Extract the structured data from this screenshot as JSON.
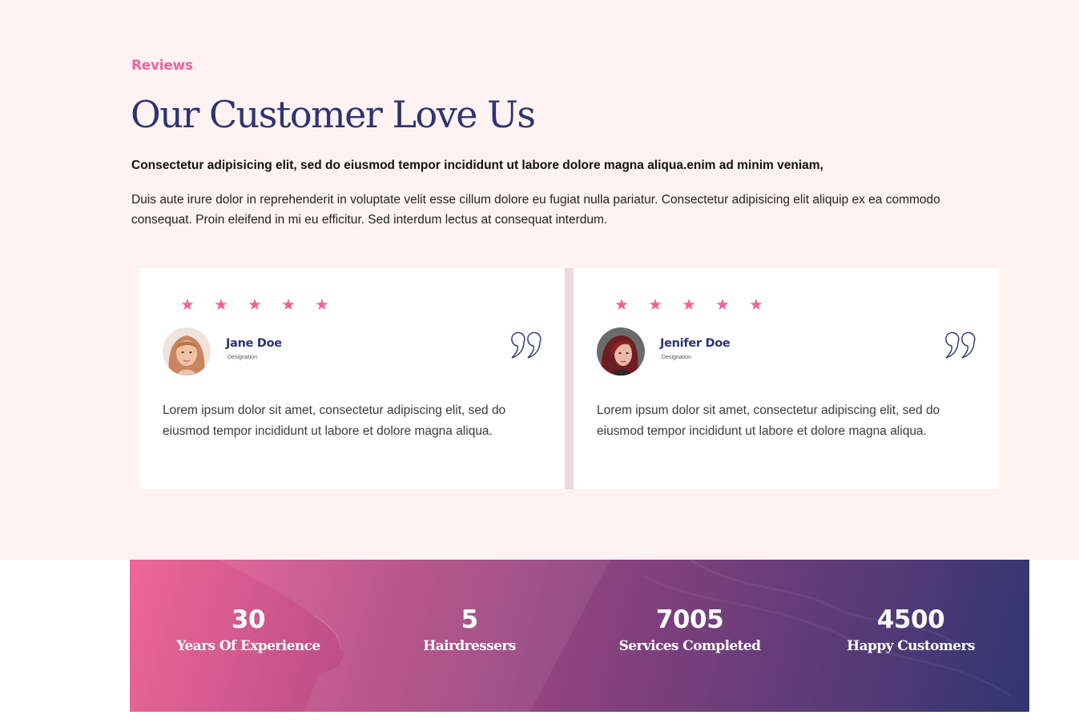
{
  "section": {
    "eyebrow": "Reviews",
    "title": "Our Customer Love Us",
    "lead": "Consectetur adipisicing elit, sed do eiusmod tempor incididunt ut labore dolore magna aliqua.enim ad minim veniam,",
    "body": "Duis aute irure dolor in reprehenderit in voluptate velit esse cillum dolore eu fugiat nulla pariatur. Consectetur adipisicing elit aliquip ex ea commodo consequat. Proin eleifend in mi eu efficitur. Sed interdum lectus at consequat interdum."
  },
  "testimonials": [
    {
      "rating": 5,
      "name": "Jane Doe",
      "role": "Designation",
      "text": "Lorem ipsum dolor sit amet, consectetur adipiscing elit, sed do eiusmod tempor incididunt ut labore et dolore magna aliqua.",
      "icon": "quote-icon"
    },
    {
      "rating": 5,
      "name": "Jenifer Doe",
      "role": "Designation",
      "text": "Lorem ipsum dolor sit amet, consectetur adipiscing elit, sed do eiusmod tempor incididunt ut labore et dolore magna aliqua.",
      "icon": "quote-icon"
    }
  ],
  "stats": [
    {
      "value": "30",
      "label": "Years Of Experience"
    },
    {
      "value": "5",
      "label": "Hairdressers"
    },
    {
      "value": "7005",
      "label": "Services Completed"
    },
    {
      "value": "4500",
      "label": "Happy Customers"
    }
  ],
  "colors": {
    "accent": "#f0639a",
    "navy": "#2c3472",
    "section_bg": "#fff2f2",
    "card_bg": "#ffffff",
    "gradient_start": "#ee6797",
    "gradient_end": "#2f366f"
  }
}
